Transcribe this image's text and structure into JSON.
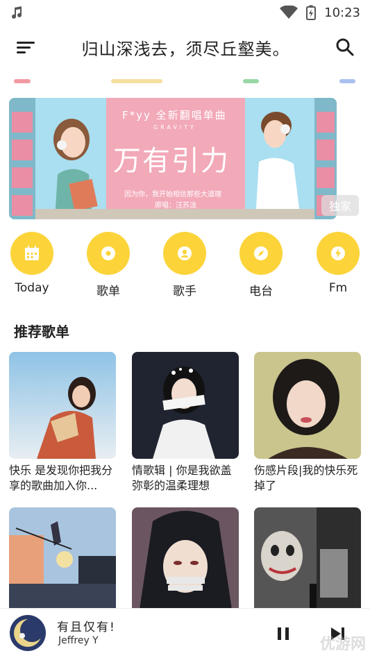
{
  "status": {
    "time": "10:23"
  },
  "app": {
    "title": "归山深浅去，须尽丘壑美。"
  },
  "tabs": {
    "colors": [
      "#f29aa4",
      "#f6dfa0",
      "#98d8a6",
      "#aac0f0"
    ]
  },
  "banner": {
    "artist_line": "F*yy  全新翻唱单曲",
    "sub_line": "GRAVITY",
    "big_title": "万有引力",
    "lyric_line": "因为你，我开始相信那些大道理",
    "credit_line": "原唱：汪苏泷",
    "badge": "独家"
  },
  "categories": [
    {
      "label": "Today",
      "icon": "calendar-icon"
    },
    {
      "label": "歌单",
      "icon": "disc-icon"
    },
    {
      "label": "歌手",
      "icon": "user-icon"
    },
    {
      "label": "电台",
      "icon": "compass-icon"
    },
    {
      "label": "Fm",
      "icon": "lightning-icon"
    }
  ],
  "section": {
    "title": "推荐歌单"
  },
  "playlists": [
    {
      "title": "快乐 是发现你把我分享的歌曲加入你..."
    },
    {
      "title": "情歌辑 | 你是我欲盖弥彰的温柔理想"
    },
    {
      "title": "伤感片段|我的快乐死掉了"
    },
    {
      "title": ""
    },
    {
      "title": ""
    },
    {
      "title": ""
    }
  ],
  "player": {
    "title": "有且仅有!",
    "artist": "Jeffrey Y"
  },
  "watermark": "优游网"
}
